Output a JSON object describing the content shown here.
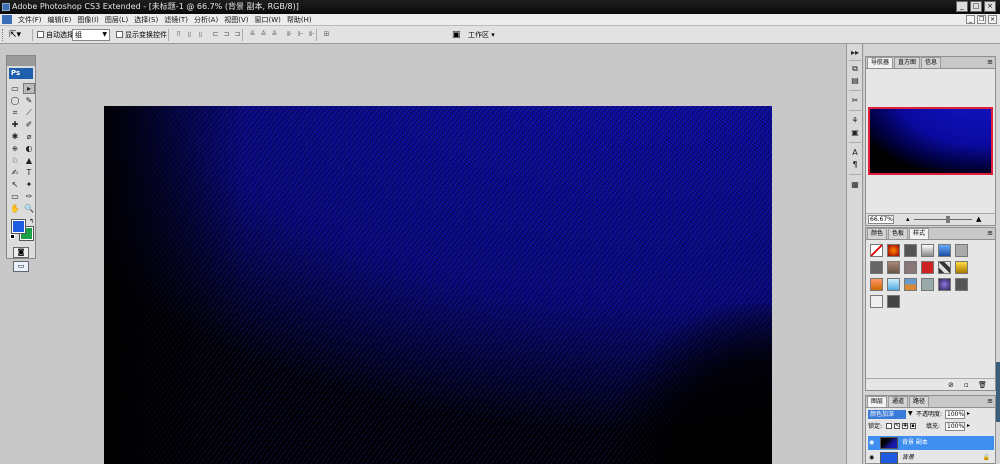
{
  "titlebar": {
    "title": "Adobe Photoshop CS3 Extended - [未标题-1 @ 66.7% (背景 副本, RGB/8)]",
    "minimize": "_",
    "maximize": "□",
    "close": "×"
  },
  "menubar": {
    "items": [
      "文件(F)",
      "编辑(E)",
      "图像(I)",
      "图层(L)",
      "选择(S)",
      "滤镜(T)",
      "分析(A)",
      "视图(V)",
      "窗口(W)",
      "帮助(H)"
    ]
  },
  "options": {
    "auto_select_label": "自动选择:",
    "auto_select_value": "组",
    "show_transform_label": "显示变换控件",
    "workspace_label": "工作区 ▾"
  },
  "toolbox": {
    "logo": "Ps",
    "tools": [
      "▭",
      "▸",
      "◯",
      "✎",
      "⌗",
      "⟋",
      "✚",
      "✐",
      "✱",
      "⌀",
      "⎈",
      "◐",
      "♘",
      "▲",
      "✍",
      "T",
      "↖",
      "✦",
      "▭",
      "✑",
      "✋",
      "🔍"
    ]
  },
  "navigator_panel": {
    "tabs": [
      "导航器",
      "直方图",
      "信息"
    ],
    "zoom": "66.67%"
  },
  "styles_panel": {
    "tabs": [
      "颜色",
      "色板",
      "样式"
    ]
  },
  "layers_panel": {
    "tabs": [
      "图层",
      "通道",
      "路径"
    ],
    "blend_mode": "颜色加深",
    "opacity_label": "不透明度:",
    "opacity_value": "100%",
    "lock_label": "锁定:",
    "fill_label": "填充:",
    "fill_value": "100%",
    "layers": [
      {
        "name": "背景 副本",
        "selected": true
      },
      {
        "name": "背景",
        "selected": false
      }
    ]
  },
  "colors": {
    "foreground": "#1e5be0",
    "background": "#1aa046",
    "selection": "#3e8ff0",
    "canvas_blue": "#1616c8"
  }
}
